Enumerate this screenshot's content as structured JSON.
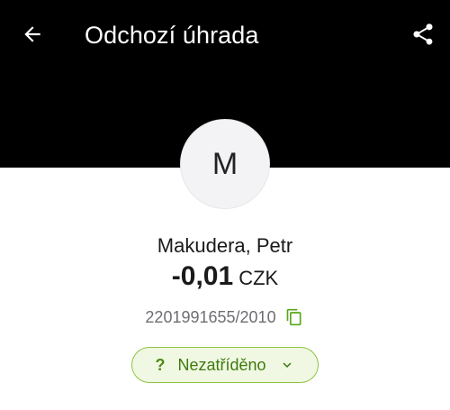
{
  "header": {
    "title": "Odchozí úhrada",
    "back_icon": "arrow-left-icon",
    "share_icon": "share-icon",
    "background_color": "#000000"
  },
  "counterparty": {
    "avatar_initial": "M",
    "name": "Makudera, Petr"
  },
  "amount": {
    "value": "-0,01",
    "currency": "CZK"
  },
  "account": {
    "number": "2201991655/2010",
    "copy_icon": "copy-icon"
  },
  "category": {
    "icon_glyph": "?",
    "label": "Nezatříděno",
    "chevron_icon": "chevron-down-icon",
    "accent_color": "#8cc43f"
  }
}
